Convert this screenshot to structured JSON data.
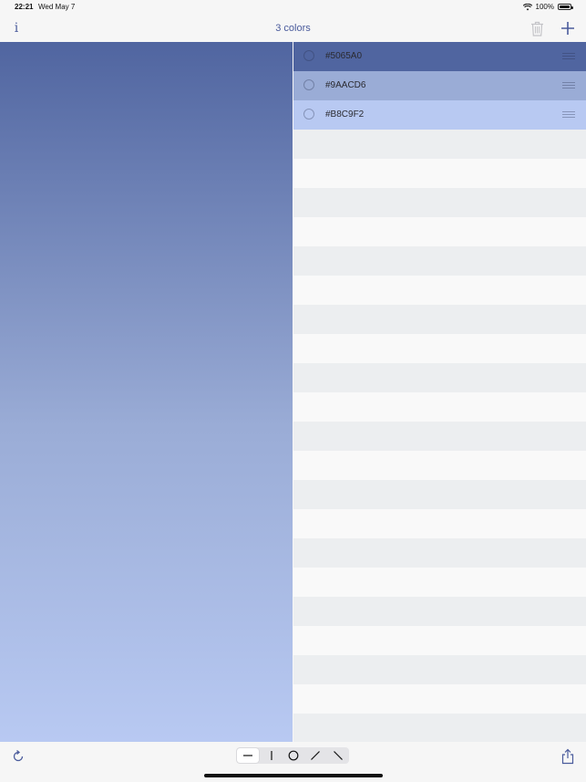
{
  "status_bar": {
    "time": "22:21",
    "date": "Wed May 7",
    "battery": "100%"
  },
  "nav": {
    "title": "3 colors",
    "info_label": "i",
    "accent_color": "#4a5b9c"
  },
  "colors": [
    {
      "label": "#5065A0",
      "hex": "#5065A0"
    },
    {
      "label": "#9AACD6",
      "hex": "#9AACD6"
    },
    {
      "label": "#B8C9F2",
      "hex": "#B8C9F2"
    }
  ],
  "toolbar": {
    "gradient_modes": [
      "horizontal-line-icon",
      "vertical-line-icon",
      "circle-icon",
      "diagonal-up-icon",
      "diagonal-down-icon"
    ],
    "selected_mode": "horizontal-line-icon"
  }
}
